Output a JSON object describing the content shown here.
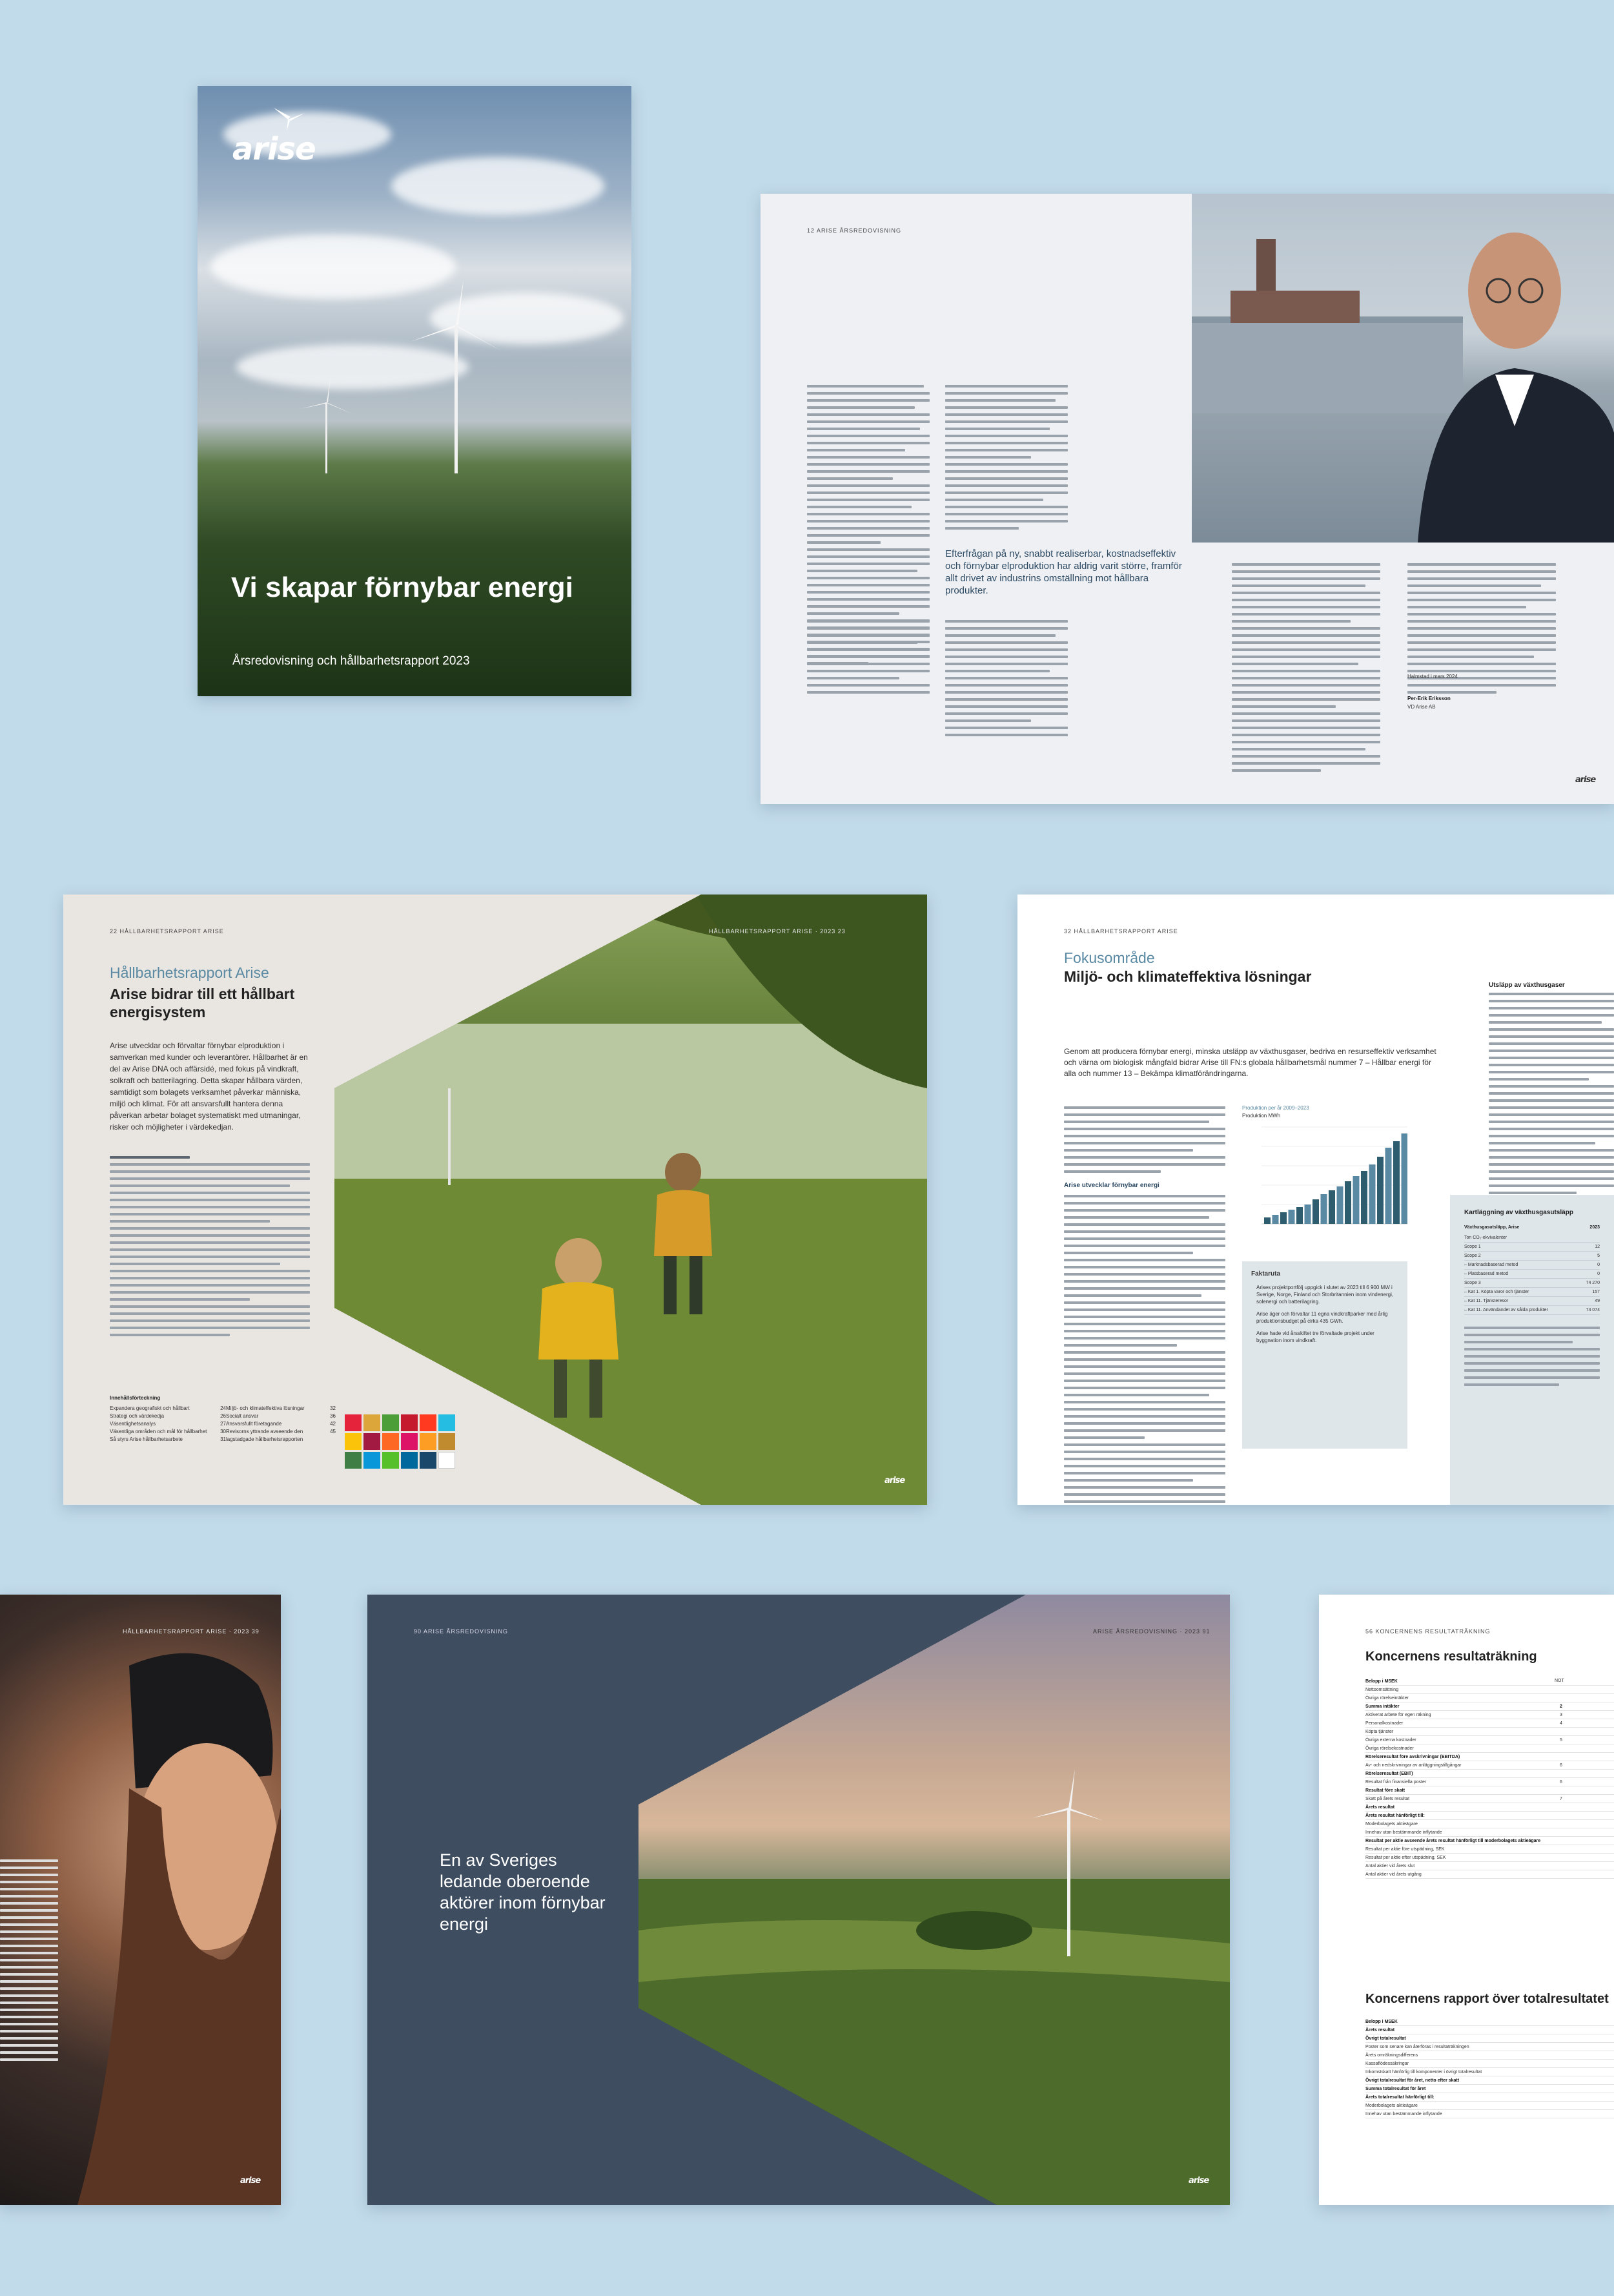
{
  "cover": {
    "logo": "arise",
    "title": "Vi skapar förnybar energi",
    "subtitle": "Årsredovisning och hållbarhetsrapport 2023"
  },
  "ceo_spread": {
    "header": "12   ARISE ÅRSREDOVISNING",
    "pull_quote": "Efterfrågan på ny, snabbt realiserbar, kostnads­effektiv och förnybar elproduktion har aldrig varit större, framför allt drivet av industrins omställning mot hållbara produkter.",
    "signature_date": "Halmstad i mars 2024",
    "signature_name": "Per-Erik Eriksson",
    "signature_title": "VD Arise AB",
    "footer_logo": "arise"
  },
  "sustainability_spread": {
    "header": "22   HÅLLBARHETSRAPPORT ARISE",
    "header_right": "HÅLLBARHETSRAPPORT ARISE · 2023   23",
    "heading_blue": "Hållbarhetsrapport Arise",
    "heading_main": "Arise bidrar till ett hållbart energisystem",
    "intro": "Arise utvecklar och förvaltar förnybar elproduktion i samverkan med kunder och leverantörer. Hållbarhet är en del av Arise DNA och affärsidé, med fokus på vindkraft, solkraft och batterilagring. Detta skapar hållbara värden, samtidigt som bolagets verksamhet påverkar människa, miljö och klimat. För att ansvarsfullt hantera denna påverkan arbetar bolaget systematiskt med utmaningar, risker och möjligheter i värdekedjan.",
    "toc_title": "Innehållsförteckning",
    "toc_left": [
      {
        "label": "Expandera geografiskt och hållbart",
        "page": "24"
      },
      {
        "label": "Strategi och värdekedja",
        "page": "26"
      },
      {
        "label": "Väsentlighetsanalys",
        "page": "27"
      },
      {
        "label": "Väsentliga områden och mål för hållbarhet",
        "page": "30"
      },
      {
        "label": "Så styrs Arise hållbarhetsarbete",
        "page": "31"
      }
    ],
    "toc_right": [
      {
        "label": "Miljö- och klimateffektiva lösningar",
        "page": "32"
      },
      {
        "label": "Socialt ansvar",
        "page": "36"
      },
      {
        "label": "Ansvarsfullt företagande",
        "page": "42"
      },
      {
        "label": "Revisorns yttrande avseende den lagstadgade hållbarhetsrapporten",
        "page": "45"
      }
    ],
    "footer_logo": "arise"
  },
  "focus_spread": {
    "header": "32   HÅLLBARHETSRAPPORT ARISE",
    "heading_blue": "Fokusområde",
    "heading_main": "Miljö- och klimateffektiva lösningar",
    "intro": "Genom att producera förnybar energi, minska utsläpp av växthusgaser, bedriva en resurseffektiv verksamhet och värna om biologisk mångfald bidrar Arise till FN:s globala hållbarhetsmål nummer 7 – Hållbar energi för alla och nummer 13 – Bekämpa klimatförändringarna.",
    "subheading": "Arise utvecklar förnybar energi",
    "chart_title": "Produktion per år 2009–2023",
    "chart_unit": "Produktion MWh",
    "facts_title": "Faktaruta",
    "facts": [
      "Arises projektportfölj uppgick i slutet av 2023 till 6 900 MW i Sverige, Norge, Finland och Storbritannien inom vindenergi, solenergi och batterilagring.",
      "Arise äger och förvaltar 11 egna vindkraftparker med årlig produktionsbudget på cirka 435 GWh.",
      "Arise hade vid årsskiftet tre förvaltade projekt under byggnation inom vindkraft."
    ],
    "right_heading": "Utsläpp av växthusgaser",
    "table_title": "Kartläggning av växthusgasutsläpp",
    "table_subtitle": "Växthusgasutsläpp, Arise",
    "table_col": "2023",
    "table_rows": [
      {
        "label": "Ton CO₂-ekvivalenter",
        "value": ""
      },
      {
        "label": "Scope 1",
        "value": "12"
      },
      {
        "label": "Scope 2",
        "value": "5"
      },
      {
        "label": "– Marknadsbaserad metod",
        "value": "0"
      },
      {
        "label": "– Platsbaserad metod",
        "value": "0"
      },
      {
        "label": "Scope 3",
        "value": "74 270"
      },
      {
        "label": "– Kat 1. Köpta varor och tjänster",
        "value": "157"
      },
      {
        "label": "– Kat 11. Tjänsteresor",
        "value": "49"
      },
      {
        "label": "– Kat 11. Användandet av sålda produkter",
        "value": "74 074"
      }
    ]
  },
  "woman_page": {
    "header": "HÅLLBARHETSRAPPORT ARISE · 2023   39",
    "footer_logo": "arise"
  },
  "dark_spread": {
    "header": "90   ARISE ÅRSREDOVISNING",
    "header_right": "ARISE ÅRSREDOVISNING · 2023   91",
    "headline": "En av Sveriges ledande oberoende aktörer inom förnybar energi",
    "footer_logo": "arise"
  },
  "financial_page": {
    "header": "56   KONCERNENS RESULTATRÄKNING",
    "heading1": "Koncernens resultaträkning",
    "column": "NOT",
    "rows1": [
      {
        "label": "Belopp i MSEK",
        "bold": true,
        "note": ""
      },
      {
        "label": "Nettoomsättning",
        "bold": false,
        "note": ""
      },
      {
        "label": "Övriga rörelseintäkter",
        "bold": false,
        "note": ""
      },
      {
        "label": "Summa intäkter",
        "bold": true,
        "note": "2"
      },
      {
        "label": "Aktiverat arbete för egen räkning",
        "bold": false,
        "note": "3"
      },
      {
        "label": "Personalkostnader",
        "bold": false,
        "note": "4"
      },
      {
        "label": "Köpta tjänster",
        "bold": false,
        "note": ""
      },
      {
        "label": "Övriga externa kostnader",
        "bold": false,
        "note": "5"
      },
      {
        "label": "Övriga rörelsekostnader",
        "bold": false,
        "note": ""
      },
      {
        "label": "Rörelseresultat före avskrivningar (EBITDA)",
        "bold": true,
        "note": ""
      },
      {
        "label": "Av- och nedskrivningar av anläggningstillgångar",
        "bold": false,
        "note": "6"
      },
      {
        "label": "Rörelseresultat (EBIT)",
        "bold": true,
        "note": ""
      },
      {
        "label": "Resultat från finansiella poster",
        "bold": false,
        "note": "6"
      },
      {
        "label": "Resultat före skatt",
        "bold": true,
        "note": ""
      },
      {
        "label": "Skatt på årets resultat",
        "bold": false,
        "note": "7"
      },
      {
        "label": "Årets resultat",
        "bold": true,
        "note": ""
      },
      {
        "label": "Årets resultat hänförligt till:",
        "bold": true,
        "note": ""
      },
      {
        "label": "Moderbolagets aktieägare",
        "bold": false,
        "note": ""
      },
      {
        "label": "Innehav utan bestämmande inflytande",
        "bold": false,
        "note": ""
      },
      {
        "label": "Resultat per aktie avseende årets resultat hänförligt till moderbolagets aktieägare",
        "bold": true,
        "note": ""
      },
      {
        "label": "Resultat per aktie före utspädning, SEK",
        "bold": false,
        "note": ""
      },
      {
        "label": "Resultat per aktie efter utspädning, SEK",
        "bold": false,
        "note": ""
      },
      {
        "label": "Antal aktier vid årets slut",
        "bold": false,
        "note": ""
      },
      {
        "label": "Antal aktier vid årets utgång",
        "bold": false,
        "note": ""
      }
    ],
    "heading2": "Koncernens rapport över totalresultatet",
    "rows2": [
      {
        "label": "Belopp i MSEK",
        "bold": true
      },
      {
        "label": "Årets resultat",
        "bold": true
      },
      {
        "label": "Övrigt totalresultat",
        "bold": true
      },
      {
        "label": "Poster som senare kan återföras i resultaträkningen",
        "bold": false
      },
      {
        "label": "Årets omräkningsdifferens",
        "bold": false
      },
      {
        "label": "Kassaflödessäkringar",
        "bold": false
      },
      {
        "label": "Inkomstskatt hänförlig till komponenter i övrigt totalresultat",
        "bold": false
      },
      {
        "label": "Övrigt totalresultat för året, netto efter skatt",
        "bold": true
      },
      {
        "label": "Summa totalresultat för året",
        "bold": true
      },
      {
        "label": "Årets totalresultat hänförligt till:",
        "bold": true
      },
      {
        "label": "Moderbolagets aktieägare",
        "bold": false
      },
      {
        "label": "Innehav utan bestämmande inflytande",
        "bold": false
      }
    ]
  }
}
